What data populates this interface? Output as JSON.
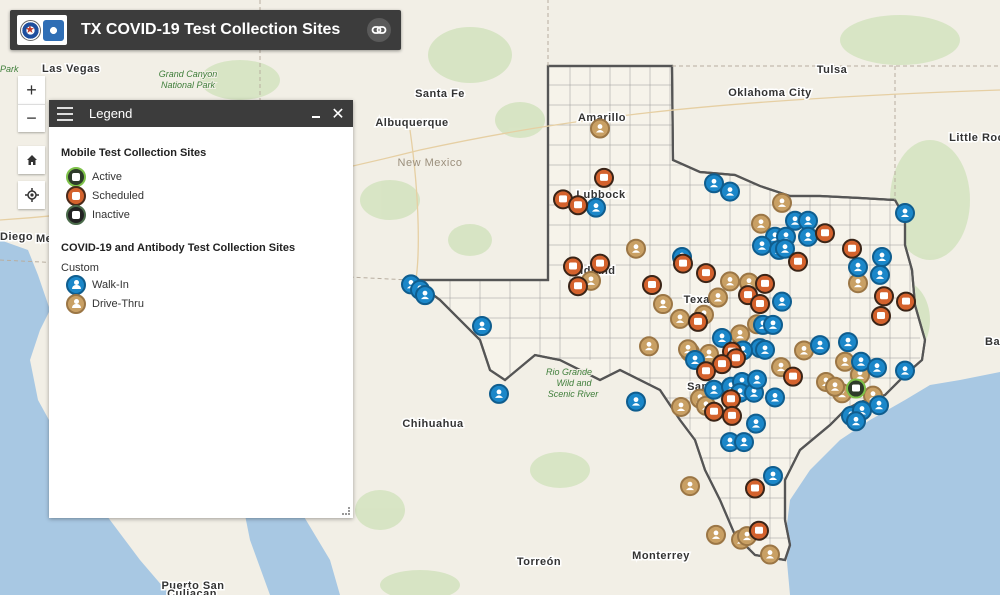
{
  "app": {
    "title": "TX COVID-19 Test Collection Sites"
  },
  "controls": {
    "zoom_in": "+",
    "zoom_out": "−",
    "close": "✕"
  },
  "legend": {
    "title": "Legend",
    "sections": [
      {
        "title": "Mobile Test Collection Sites",
        "items": [
          {
            "label": "Active",
            "icon": "mobile-active-icon"
          },
          {
            "label": "Scheduled",
            "icon": "mobile-scheduled-icon"
          },
          {
            "label": "Inactive",
            "icon": "mobile-inactive-icon"
          }
        ]
      },
      {
        "title": "COVID-19 and Antibody Test Collection Sites",
        "subtitle": "Custom",
        "items": [
          {
            "label": "Walk-In",
            "icon": "walk-in-icon"
          },
          {
            "label": "Drive-Thru",
            "icon": "drive-thru-icon"
          }
        ]
      }
    ]
  },
  "map_labels": {
    "cities": [
      "Las Vegas",
      "Santa Fe",
      "Albuquerque",
      "Oklahoma City",
      "Tulsa",
      "Little Rock",
      "Amarillo",
      "Lubbock",
      "Midland",
      "Texas",
      "San Antonio",
      "Chihuahua",
      "Torreón",
      "Monterrey",
      "Puerto San",
      "Culiacan",
      "Diego",
      "Me",
      "Ba",
      "Park"
    ],
    "parks": [
      "Grand Canyon",
      "National Park",
      "Rio Grande",
      "Wild and",
      "Scenic River"
    ],
    "regions": [
      "New Mexico"
    ]
  },
  "colors": {
    "walk_in": "#1b87c9",
    "drive_thru": "#c9a064",
    "scheduled": "#d4622d",
    "active": "#7ec24a",
    "texas_border": "#555555",
    "water": "#a8c8e3",
    "land": "#f2efe6"
  },
  "sites": {
    "walk_in": [
      [
        0.714,
        0.308
      ],
      [
        0.73,
        0.322
      ],
      [
        0.596,
        0.349
      ],
      [
        0.905,
        0.358
      ],
      [
        0.795,
        0.371
      ],
      [
        0.808,
        0.371
      ],
      [
        0.775,
        0.398
      ],
      [
        0.786,
        0.398
      ],
      [
        0.808,
        0.398
      ],
      [
        0.762,
        0.413
      ],
      [
        0.779,
        0.42
      ],
      [
        0.785,
        0.418
      ],
      [
        0.882,
        0.432
      ],
      [
        0.858,
        0.449
      ],
      [
        0.88,
        0.462
      ],
      [
        0.682,
        0.432
      ],
      [
        0.411,
        0.478
      ],
      [
        0.42,
        0.487
      ],
      [
        0.425,
        0.496
      ],
      [
        0.482,
        0.548
      ],
      [
        0.782,
        0.507
      ],
      [
        0.763,
        0.546
      ],
      [
        0.773,
        0.546
      ],
      [
        0.722,
        0.568
      ],
      [
        0.76,
        0.585
      ],
      [
        0.743,
        0.589
      ],
      [
        0.848,
        0.575
      ],
      [
        0.82,
        0.58
      ],
      [
        0.861,
        0.608
      ],
      [
        0.877,
        0.618
      ],
      [
        0.905,
        0.623
      ],
      [
        0.714,
        0.655
      ],
      [
        0.731,
        0.65
      ],
      [
        0.742,
        0.642
      ],
      [
        0.74,
        0.66
      ],
      [
        0.754,
        0.66
      ],
      [
        0.636,
        0.675
      ],
      [
        0.499,
        0.662
      ],
      [
        0.851,
        0.699
      ],
      [
        0.879,
        0.681
      ],
      [
        0.862,
        0.69
      ],
      [
        0.856,
        0.708
      ],
      [
        0.756,
        0.712
      ],
      [
        0.73,
        0.743
      ],
      [
        0.744,
        0.743
      ],
      [
        0.773,
        0.8
      ],
      [
        0.695,
        0.605
      ],
      [
        0.775,
        0.668
      ],
      [
        0.757,
        0.638
      ],
      [
        0.765,
        0.588
      ]
    ],
    "drive_thru": [
      [
        0.6,
        0.216
      ],
      [
        0.636,
        0.418
      ],
      [
        0.761,
        0.376
      ],
      [
        0.782,
        0.341
      ],
      [
        0.591,
        0.472
      ],
      [
        0.663,
        0.511
      ],
      [
        0.68,
        0.536
      ],
      [
        0.74,
        0.562
      ],
      [
        0.757,
        0.545
      ],
      [
        0.749,
        0.475
      ],
      [
        0.73,
        0.473
      ],
      [
        0.718,
        0.5
      ],
      [
        0.704,
        0.529
      ],
      [
        0.858,
        0.476
      ],
      [
        0.804,
        0.589
      ],
      [
        0.709,
        0.595
      ],
      [
        0.69,
        0.592
      ],
      [
        0.649,
        0.582
      ],
      [
        0.688,
        0.587
      ],
      [
        0.781,
        0.617
      ],
      [
        0.826,
        0.642
      ],
      [
        0.845,
        0.608
      ],
      [
        0.86,
        0.63
      ],
      [
        0.873,
        0.665
      ],
      [
        0.842,
        0.661
      ],
      [
        0.835,
        0.65
      ],
      [
        0.7,
        0.67
      ],
      [
        0.706,
        0.682
      ],
      [
        0.681,
        0.684
      ],
      [
        0.69,
        0.817
      ],
      [
        0.716,
        0.899
      ],
      [
        0.741,
        0.907
      ],
      [
        0.77,
        0.932
      ],
      [
        0.747,
        0.901
      ]
    ],
    "scheduled": [
      [
        0.604,
        0.299
      ],
      [
        0.563,
        0.335
      ],
      [
        0.578,
        0.345
      ],
      [
        0.573,
        0.448
      ],
      [
        0.578,
        0.481
      ],
      [
        0.6,
        0.443
      ],
      [
        0.652,
        0.479
      ],
      [
        0.683,
        0.443
      ],
      [
        0.706,
        0.459
      ],
      [
        0.748,
        0.496
      ],
      [
        0.765,
        0.477
      ],
      [
        0.76,
        0.511
      ],
      [
        0.825,
        0.392
      ],
      [
        0.852,
        0.418
      ],
      [
        0.798,
        0.44
      ],
      [
        0.884,
        0.498
      ],
      [
        0.906,
        0.507
      ],
      [
        0.881,
        0.531
      ],
      [
        0.698,
        0.541
      ],
      [
        0.732,
        0.591
      ],
      [
        0.736,
        0.602
      ],
      [
        0.722,
        0.612
      ],
      [
        0.706,
        0.624
      ],
      [
        0.793,
        0.633
      ],
      [
        0.731,
        0.671
      ],
      [
        0.714,
        0.692
      ],
      [
        0.732,
        0.699
      ],
      [
        0.755,
        0.821
      ],
      [
        0.759,
        0.892
      ]
    ],
    "active": [
      [
        0.856,
        0.653
      ]
    ]
  }
}
